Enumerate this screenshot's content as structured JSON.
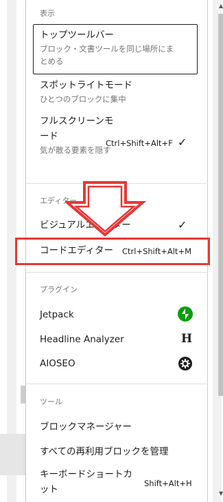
{
  "view": {
    "section_label": "表示",
    "top_toolbar": {
      "title": "トップツールバー",
      "desc": "ブロック・文書ツールを同じ場所にまとめる"
    },
    "spotlight": {
      "title": "スポットライトモード",
      "desc": "ひとつのブロックに集中"
    },
    "fullscreen": {
      "title": "フルスクリーンモード",
      "desc": "気が散る要素を隠す",
      "shortcut": "Ctrl+Shift+Alt+F",
      "check": "✓"
    }
  },
  "editor": {
    "section_label": "エディター",
    "visual": {
      "title": "ビジュアルエディター",
      "check": "✓"
    },
    "code": {
      "title": "コードエディター",
      "shortcut": "Ctrl+Shift+Alt+M"
    }
  },
  "plugins": {
    "section_label": "プラグイン",
    "items": [
      {
        "label": "Jetpack",
        "icon": "jetpack-icon"
      },
      {
        "label": "Headline Analyzer",
        "icon": "h-icon",
        "icon_glyph": "H"
      },
      {
        "label": "AIOSEO",
        "icon": "gear-icon"
      }
    ]
  },
  "tools": {
    "section_label": "ツール",
    "block_manager": "ブロックマネージャー",
    "reusable_blocks": "すべての再利用ブロックを管理",
    "keyboard_shortcuts": {
      "title": "キーボードショートカット",
      "shortcut": "Shift+Alt+H"
    }
  },
  "colors": {
    "annotation": "#e53935",
    "jetpack": "#069e08"
  }
}
